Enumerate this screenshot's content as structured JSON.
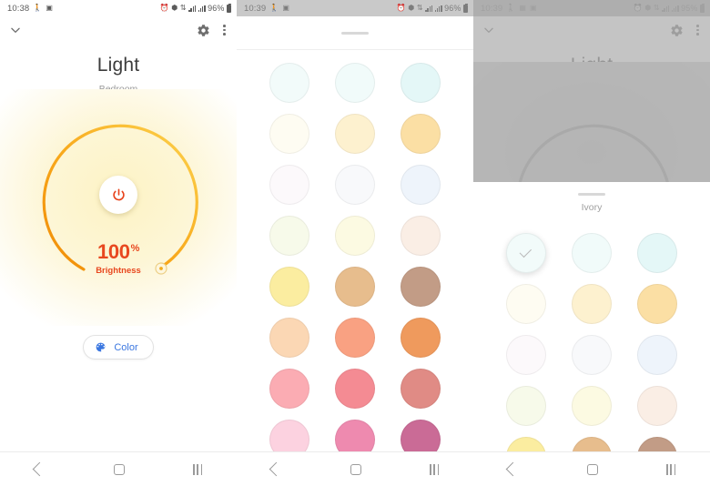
{
  "app": {
    "device_name": "Light",
    "room_name": "Bedroom"
  },
  "panel1": {
    "status_bar": {
      "time": "10:38",
      "battery": "96%"
    },
    "appbar": {
      "collapse_icon": "chevron-down-icon",
      "settings_icon": "gear-icon",
      "more_icon": "kebab-menu-icon"
    },
    "dial": {
      "brightness_value": "100",
      "brightness_unit": "%",
      "brightness_caption": "Brightness",
      "power_icon": "power-icon",
      "arc_color_start": "#f59c0b",
      "arc_color_end": "#fbd24a",
      "accent_color": "#e8481f"
    },
    "color_button": {
      "label": "Color",
      "icon": "palette-icon",
      "color": "#3b77e0"
    },
    "navbar": {
      "back": "back-icon",
      "home": "home-icon",
      "recents": "recents-icon"
    }
  },
  "panel2": {
    "status_bar": {
      "time": "10:39",
      "battery": "96%"
    },
    "sheet": {
      "grabber": "drag-handle"
    },
    "swatch_rows": [
      [
        "#f2fbfa",
        "#f1fbfa",
        "#e4f7f7"
      ],
      [
        "#fefcf2",
        "#fdf1cf",
        "#fbdfa4"
      ],
      [
        "#fcf9fb",
        "#f8f9fb",
        "#eef4fb"
      ],
      [
        "#f7faea",
        "#fcfae2",
        "#faeee5"
      ],
      [
        "#fbeda0",
        "#e7bd8d",
        "#c29c86"
      ],
      [
        "#fbd7b4",
        "#f9a182",
        "#ef9a5d"
      ],
      [
        "#fbacb3",
        "#f48b93",
        "#e08b85"
      ],
      [
        "#fcd2e0",
        "#ee8aaf",
        "#ca6b96"
      ]
    ],
    "navbar": {
      "back": "back-icon",
      "home": "home-icon",
      "recents": "recents-icon"
    }
  },
  "panel3": {
    "status_bar": {
      "time": "10:39",
      "battery": "95%"
    },
    "appbar": {
      "collapse_icon": "chevron-down-icon",
      "settings_icon": "gear-icon",
      "more_icon": "kebab-menu-icon"
    },
    "sheet": {
      "grabber": "drag-handle",
      "title": "Ivory"
    },
    "selected_index": 0,
    "selected_check": "check-icon",
    "swatch_rows": [
      [
        "#f2fbfa",
        "#f1fbfa",
        "#e4f7f7"
      ],
      [
        "#fefcf2",
        "#fdf1cf",
        "#fbdfa4"
      ],
      [
        "#fcf9fb",
        "#f8f9fb",
        "#eef4fb"
      ],
      [
        "#f7faea",
        "#fcfae2",
        "#faeee5"
      ],
      [
        "#fbeda0",
        "#e7bd8d",
        "#c29c86"
      ]
    ],
    "navbar": {
      "back": "back-icon",
      "home": "home-icon",
      "recents": "recents-icon"
    }
  }
}
